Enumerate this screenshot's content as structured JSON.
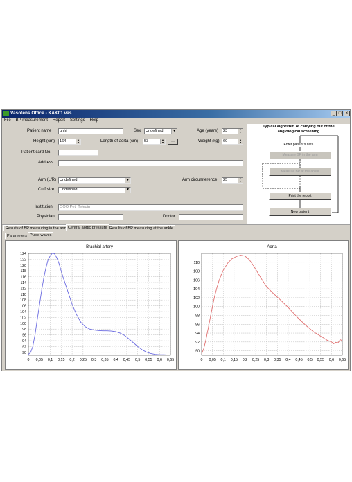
{
  "window": {
    "title": "Vasotens Office - KAK01.vas",
    "minimize": "_",
    "maximize": "□",
    "close": "×"
  },
  "menu": [
    "File",
    "BP measurement",
    "Report",
    "Settings",
    "Help"
  ],
  "form": {
    "patient_name_label": "Patient name",
    "patient_name_value": "ghhj",
    "sex_label": "Sex",
    "sex_value": "Undefined",
    "age_label": "Age (years)",
    "age_value": "23",
    "height_label": "Height (cm)",
    "height_value": "164",
    "aorta_label": "Length of aorta (cm)",
    "aorta_value": "53",
    "aorta_btn": "...",
    "weight_label": "Weight (kg)",
    "weight_value": "60",
    "card_label": "Patient card No.",
    "card_value": "",
    "address_label": "Address",
    "address_value": "",
    "arm_label": "Arm (L/R)",
    "arm_value": "Undefined",
    "arm_circ_label": "Arm circumference",
    "arm_circ_value": "25",
    "cuff_label": "Cuff size",
    "cuff_value": "Undefined",
    "institution_label": "Institution",
    "institution_value": "OOO Petr Telegin",
    "physician_label": "Physician",
    "physician_value": "",
    "doctor_label": "Doctor",
    "doctor_value": ""
  },
  "algorithm": {
    "title_line1": "Typical algorithm of carrying out of the",
    "title_line2": "angiological screening",
    "step_enter": "Enter patient's data",
    "step_arm": "Measure BP in the arm",
    "step_ankle": "Measure BP at the ankle",
    "step_print": "Print the report",
    "step_new": "New patient"
  },
  "tabs": {
    "main": [
      "Results of BP measuring in the arm",
      "Central aortic pressure",
      "Results of BP measuring at the ankle"
    ],
    "sub": [
      "Parameters",
      "Pulse waves"
    ]
  },
  "colors": {
    "brachial_line": "#6a6ae0",
    "aorta_line": "#e07070"
  },
  "chart_data": [
    {
      "type": "line",
      "title": "Brachial artery",
      "xlabel": "",
      "ylabel": "",
      "xlim": [
        0,
        0.65
      ],
      "ylim": [
        89,
        124
      ],
      "x_ticks": [
        "0",
        "0,05",
        "0,1",
        "0,15",
        "0,2",
        "0,25",
        "0,3",
        "0,35",
        "0,4",
        "0,45",
        "0,5",
        "0,55",
        "0,6",
        "0,65"
      ],
      "y_ticks": [
        90,
        92,
        94,
        96,
        98,
        100,
        102,
        104,
        106,
        108,
        110,
        112,
        114,
        116,
        118,
        120,
        122,
        124
      ],
      "grid": true,
      "series": [
        {
          "x": [
            0,
            0.01,
            0.02,
            0.03,
            0.04,
            0.05,
            0.06,
            0.07,
            0.08,
            0.09,
            0.1,
            0.11,
            0.12,
            0.13,
            0.14,
            0.15,
            0.16,
            0.18,
            0.2,
            0.22,
            0.24,
            0.26,
            0.28,
            0.3,
            0.32,
            0.34,
            0.36,
            0.38,
            0.4,
            0.42,
            0.44,
            0.46,
            0.48,
            0.5,
            0.52,
            0.54,
            0.56,
            0.58,
            0.6,
            0.62,
            0.64
          ],
          "y": [
            89.3,
            90,
            92,
            96,
            101,
            106,
            111,
            115.5,
            119,
            121.8,
            123.2,
            124.1,
            123.8,
            122.5,
            120.5,
            118,
            115.5,
            111,
            106.5,
            103,
            100.3,
            98.8,
            98,
            97.7,
            97.5,
            97.4,
            97.4,
            97.3,
            97.1,
            96.6,
            95.8,
            94.6,
            93.3,
            92,
            90.9,
            90.1,
            89.6,
            89.3,
            89.2,
            89.2,
            89.1
          ]
        }
      ]
    },
    {
      "type": "line",
      "title": "Aorta",
      "xlabel": "",
      "ylabel": "",
      "xlim": [
        0,
        0.65
      ],
      "ylim": [
        89,
        112
      ],
      "x_ticks": [
        "0",
        "0,05",
        "0,1",
        "0,15",
        "0,2",
        "0,25",
        "0,3",
        "0,35",
        "0,4",
        "0,45",
        "0,5",
        "0,55",
        "0,6",
        "0,65"
      ],
      "y_ticks": [
        90,
        92,
        94,
        96,
        98,
        100,
        102,
        104,
        106,
        108,
        110
      ],
      "grid": true,
      "series": [
        {
          "x": [
            0,
            0.01,
            0.02,
            0.03,
            0.04,
            0.05,
            0.06,
            0.07,
            0.08,
            0.09,
            0.1,
            0.12,
            0.14,
            0.16,
            0.18,
            0.2,
            0.22,
            0.24,
            0.26,
            0.28,
            0.3,
            0.33,
            0.36,
            0.4,
            0.44,
            0.48,
            0.52,
            0.56,
            0.58,
            0.6,
            0.61,
            0.62,
            0.63,
            0.64,
            0.65
          ],
          "y": [
            89.3,
            90.5,
            92.5,
            95,
            97.5,
            100,
            102.3,
            104.2,
            105.8,
            107.1,
            108.2,
            109.8,
            110.8,
            111.3,
            111.6,
            111.4,
            110.6,
            109.2,
            107.6,
            106,
            104.5,
            103,
            101.7,
            99.8,
            97.7,
            95.8,
            94.2,
            93,
            92.4,
            92,
            91.6,
            91.9,
            91.8,
            92.5,
            92.3
          ]
        }
      ]
    }
  ]
}
